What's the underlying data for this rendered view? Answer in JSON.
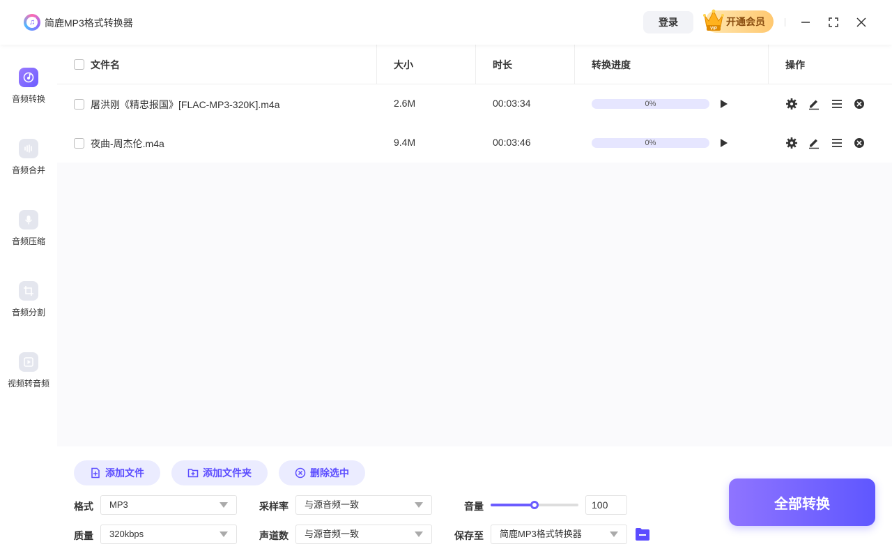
{
  "app": {
    "title": "简鹿MP3格式转换器"
  },
  "titlebar": {
    "login_label": "登录",
    "vip_label": "开通会员"
  },
  "sidebar": {
    "items": [
      {
        "label": "音频转换",
        "icon": "disc-icon",
        "active": true
      },
      {
        "label": "音频合并",
        "icon": "waveform-icon",
        "active": false
      },
      {
        "label": "音频压缩",
        "icon": "microphone-icon",
        "active": false
      },
      {
        "label": "音频分割",
        "icon": "crop-icon",
        "active": false
      },
      {
        "label": "视频转音频",
        "icon": "video-play-icon",
        "active": false
      }
    ]
  },
  "table": {
    "headers": {
      "name": "文件名",
      "size": "大小",
      "duration": "时长",
      "progress": "转换进度",
      "actions": "操作"
    },
    "rows": [
      {
        "name": "屠洪刚《精忠报国》[FLAC-MP3-320K].m4a",
        "size": "2.6M",
        "duration": "00:03:34",
        "progress": "0%"
      },
      {
        "name": "夜曲-周杰伦.m4a",
        "size": "9.4M",
        "duration": "00:03:46",
        "progress": "0%"
      }
    ]
  },
  "toolbar": {
    "add_file_label": "添加文件",
    "add_folder_label": "添加文件夹",
    "delete_selected_label": "删除选中"
  },
  "settings": {
    "format_label": "格式",
    "format_value": "MP3",
    "quality_label": "质量",
    "quality_value": "320kbps",
    "sample_rate_label": "采样率",
    "sample_rate_value": "与源音频一致",
    "channels_label": "声道数",
    "channels_value": "与源音频一致",
    "volume_label": "音量",
    "volume_value": "100",
    "volume_fraction": 0.5,
    "save_to_label": "保存至",
    "save_to_value": "简鹿MP3格式转换器"
  },
  "actions": {
    "convert_all_label": "全部转换"
  },
  "colors": {
    "accent": "#6b5cff",
    "accent_light": "#ebecff",
    "vip_gold": "#ffc870"
  }
}
